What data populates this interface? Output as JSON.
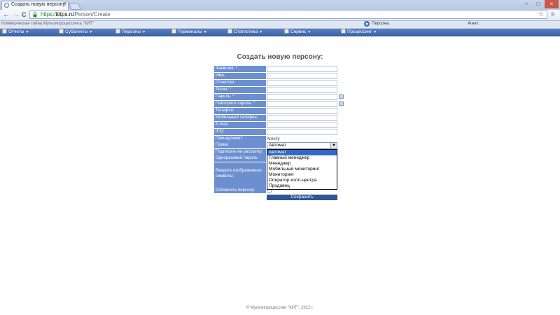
{
  "browser": {
    "tab_title": "Создать новую персону!",
    "tab_close": "×",
    "url_scheme": "https://",
    "url_host": "kitps.ru",
    "url_path": "/Person/Create",
    "window_controls": [
      "–",
      "□",
      "×"
    ],
    "back_glyph": "←",
    "forward_glyph": "→",
    "reload_glyph": "C",
    "star_glyph": "☆",
    "wrench_glyph": "🔧"
  },
  "site": {
    "slogan": "Коммерческая тайна Мультипроцессинга \"КИТ\"",
    "persona_label": "Персона:",
    "agent_label": "Агент:"
  },
  "menu": [
    {
      "label": "Отчеты",
      "arrow": "▼"
    },
    {
      "label": "Субагенты",
      "arrow": "▼"
    },
    {
      "label": "Персоны",
      "arrow": "▼"
    },
    {
      "label": "Терминалы",
      "arrow": "▼"
    },
    {
      "label": "Статистика",
      "arrow": "▼"
    },
    {
      "label": "Сервис",
      "arrow": "▼"
    },
    {
      "label": "Процессинг",
      "arrow": "▼"
    }
  ],
  "form": {
    "title": "Создать новую персону:",
    "fields": [
      {
        "label": "Фамилия: *"
      },
      {
        "label": "Имя:"
      },
      {
        "label": "Отчество:"
      },
      {
        "label": "Логин: *"
      },
      {
        "label": "Пароль: *"
      },
      {
        "label": "Повторите пароль: *"
      },
      {
        "label": "Телефон:"
      },
      {
        "label": "Мобильный телефон:"
      },
      {
        "label": "E-mail:"
      },
      {
        "label": "ICQ:"
      }
    ],
    "owner_label": "Принадлежит:",
    "owner_value": "Агенту",
    "rights_label": "Права:",
    "rights_selected": "Автомат",
    "rights_arrow": "▼",
    "rights_options": [
      "Автомат",
      "Главный менеджер",
      "Менеджер",
      "Мобильный мониторинг",
      "Мониторинг",
      "Оператор колл-центра",
      "Продавец"
    ],
    "subscribe_label": "Подписать на рассылку:",
    "otp_label": "Одноразовый пароль:",
    "captcha_label": "Введите изображенные символы:",
    "disable_label": "Отключить персону:",
    "save_label": "Сохранить"
  },
  "footer": {
    "text": "© Мультипроцессинг \"КИТ\", 2012 г."
  }
}
